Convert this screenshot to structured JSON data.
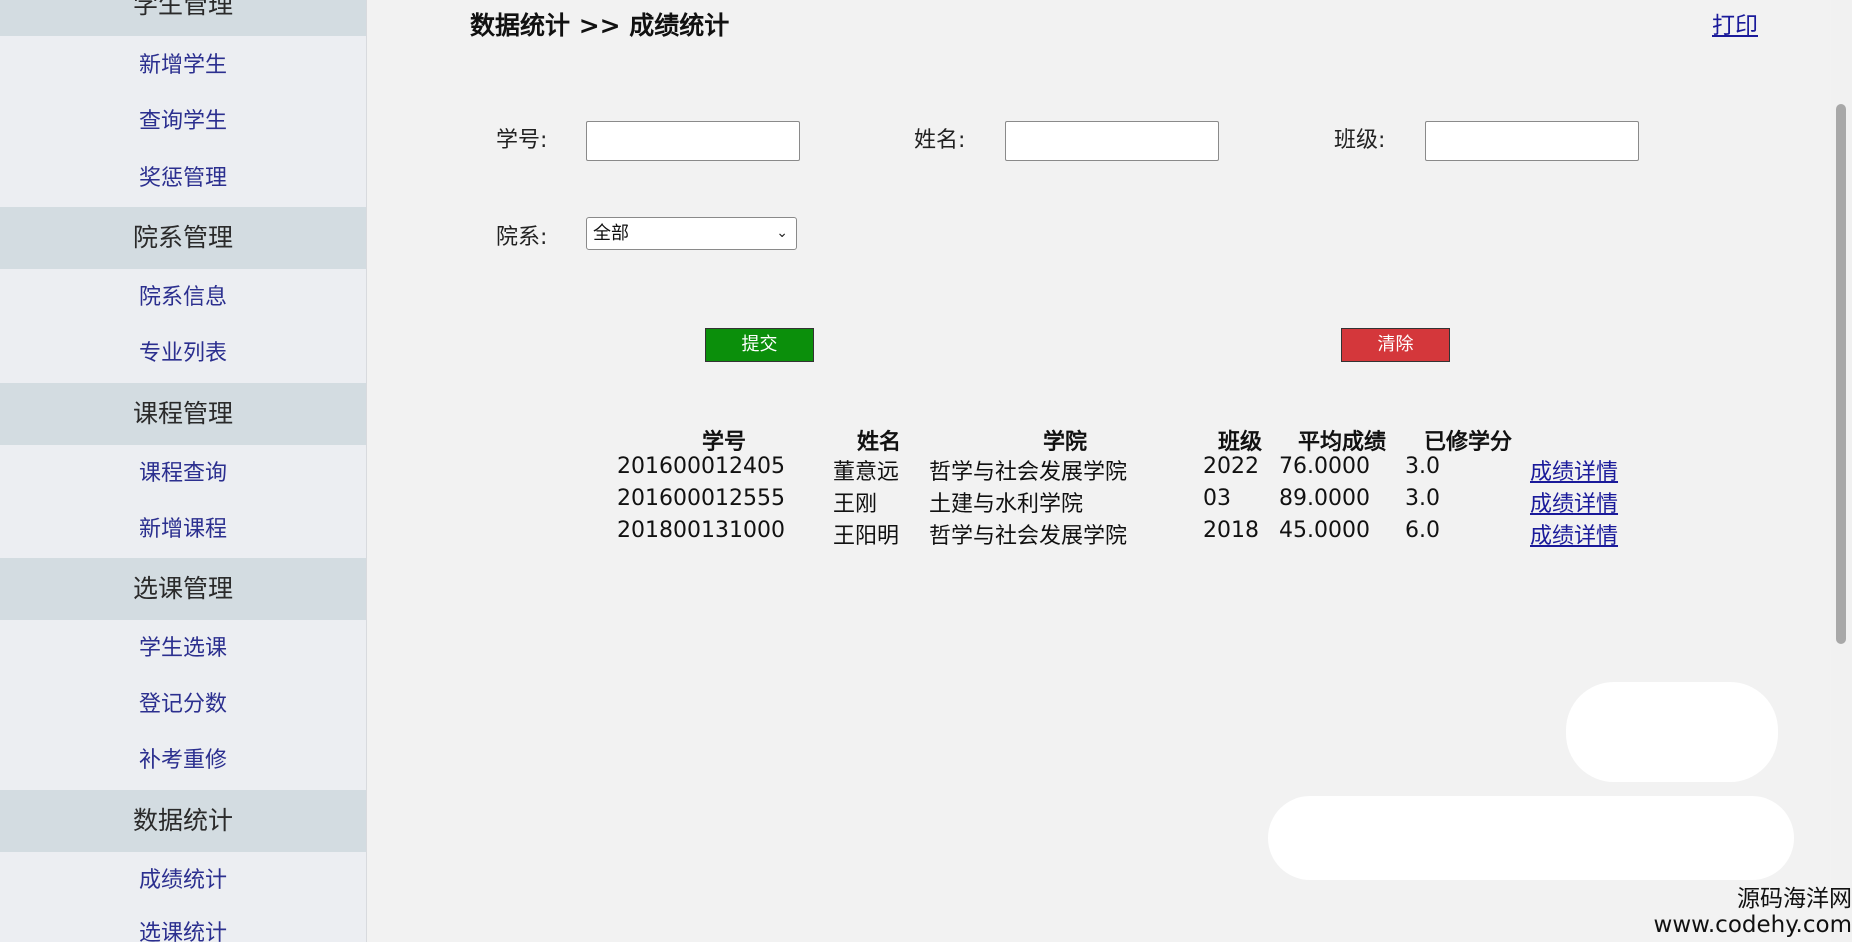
{
  "sidebar": {
    "groups": [
      {
        "label": "学生管理",
        "items": [
          "新增学生",
          "查询学生",
          "奖惩管理"
        ]
      },
      {
        "label": "院系管理",
        "items": [
          "院系信息",
          "专业列表"
        ]
      },
      {
        "label": "课程管理",
        "items": [
          "课程查询",
          "新增课程"
        ]
      },
      {
        "label": "选课管理",
        "items": [
          "学生选课",
          "登记分数",
          "补考重修"
        ]
      },
      {
        "label": "数据统计",
        "items": [
          "成绩统计",
          "选课统计"
        ]
      }
    ]
  },
  "header": {
    "title": "数据统计 >> 成绩统计",
    "print_label": "打印"
  },
  "form": {
    "student_id_label": "学号:",
    "student_id_value": "",
    "name_label": "姓名:",
    "name_value": "",
    "class_label": "班级:",
    "class_value": "",
    "department_label": "院系:",
    "department_selected": "全部",
    "submit_label": "提交",
    "clear_label": "清除"
  },
  "table": {
    "columns": [
      "学号",
      "姓名",
      "学院",
      "班级",
      "平均成绩",
      "已修学分"
    ],
    "link_label": "成绩详情",
    "rows": [
      [
        "201600012405",
        "董意远",
        "哲学与社会发展学院",
        "2022",
        "76.0000",
        "3.0"
      ],
      [
        "201600012555",
        "王刚",
        "土建与水利学院",
        "03",
        "89.0000",
        "3.0"
      ],
      [
        "201800131000",
        "王阳明",
        "哲学与社会发展学院",
        "2018",
        "45.0000",
        "6.0"
      ]
    ]
  },
  "watermark": {
    "line1": "源码海洋网",
    "line2": "www.codehy.com"
  },
  "colors": {
    "submit": "#0b8f0b",
    "clear": "#d4373b",
    "link": "#1a1a9a",
    "sidebar_group_bg": "#d3dce1"
  }
}
